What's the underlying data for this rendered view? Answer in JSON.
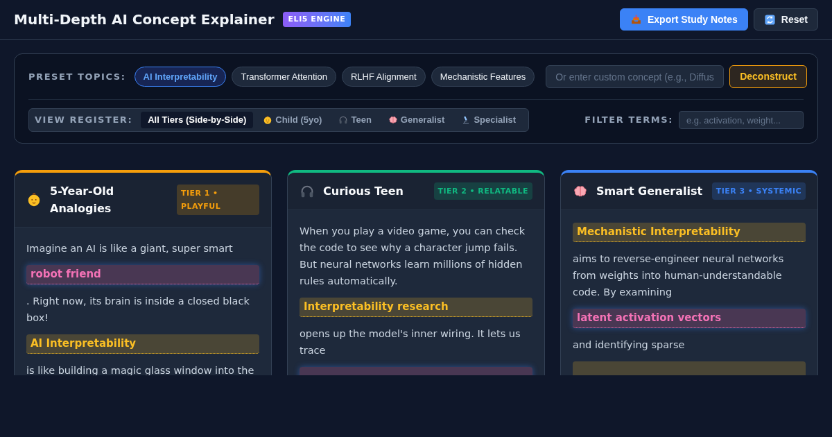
{
  "header": {
    "title": "Multi-Depth AI Concept Explainer",
    "badge": "ELI5 ENGINE",
    "buttons": [
      {
        "label": "Export Study Notes",
        "kind": "primary"
      },
      {
        "label": "Reset",
        "kind": "secondary"
      }
    ]
  },
  "controls": {
    "preset_label": "PRESET TOPICS:",
    "presets": [
      {
        "label": "AI Interpretability",
        "selected": true
      },
      {
        "label": "Transformer Attention",
        "selected": false
      },
      {
        "label": "RLHF Alignment",
        "selected": false
      },
      {
        "label": "Mechanistic Features",
        "selected": false
      }
    ],
    "custom_concept": {
      "placeholder": "Or enter custom concept (e.g., Diffus"
    },
    "deconstruct_button": "Deconstruct",
    "register_label": "VIEW REGISTER:",
    "registers": [
      {
        "label": "All Tiers (Side-by-Side)",
        "selected": true
      },
      {
        "label": "Child (5yo)",
        "selected": false
      },
      {
        "label": "Teen",
        "selected": false
      },
      {
        "label": "Generalist",
        "selected": false
      },
      {
        "label": "Specialist",
        "selected": false
      }
    ],
    "filter_label": "FILTER TERMS:",
    "filter": {
      "placeholder": "e.g. activation, weight..."
    }
  },
  "cards": [
    {
      "title": "5-Year-Old Analogies",
      "badge": "TIER 1 • PLAYFUL",
      "color": "#f59e0b",
      "body": [
        {
          "kind": "text",
          "text": "Imagine an AI is like a giant, super smart"
        },
        {
          "kind": "analogy",
          "text": "robot friend"
        },
        {
          "kind": "text",
          "text": ". Right now, its brain is inside a closed black box!"
        },
        {
          "kind": "concept",
          "text": "AI Interpretability"
        },
        {
          "kind": "text",
          "text": "is like building a magic glass window into the"
        }
      ]
    },
    {
      "title": "Curious Teen",
      "badge": "TIER 2 • RELATABLE",
      "color": "#10b981",
      "body": [
        {
          "kind": "text",
          "text": "When you play a video game, you can check the code to see why a character jump fails. But neural networks learn millions of hidden rules automatically."
        },
        {
          "kind": "concept",
          "text": "Interpretability research"
        },
        {
          "kind": "text",
          "text": "opens up the model's inner wiring. It lets us trace"
        },
        {
          "kind": "analogy"
        }
      ]
    },
    {
      "title": "Smart Generalist",
      "badge": "TIER 3 • SYSTEMIC",
      "color": "#3b82f6",
      "body": [
        {
          "kind": "concept",
          "text": "Mechanistic Interpretability"
        },
        {
          "kind": "text",
          "text": "aims to reverse-engineer neural networks from weights into human-understandable code. By examining"
        },
        {
          "kind": "analogy",
          "text": "latent activation vectors"
        },
        {
          "kind": "text",
          "text": "and identifying sparse"
        },
        {
          "kind": "concept"
        }
      ]
    }
  ]
}
